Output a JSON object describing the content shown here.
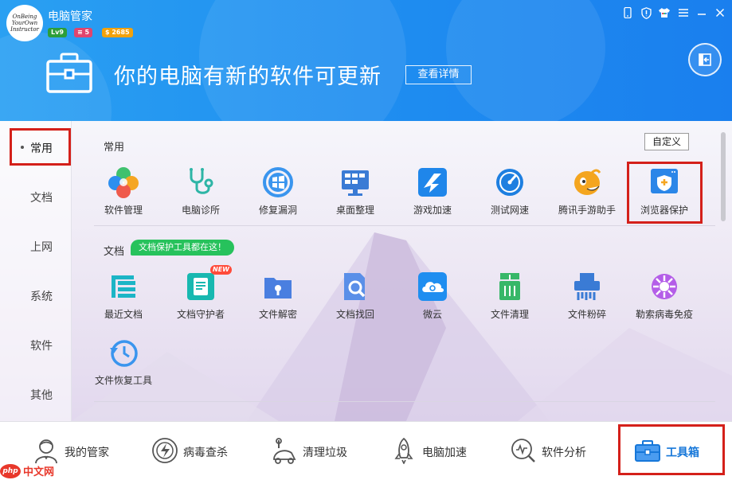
{
  "header": {
    "app_title": "电脑管家",
    "logo_text": "OnBeing YourOwn Instructor",
    "level": "Lv9",
    "vip": "5",
    "coins": "$ 2685",
    "headline": "你的电脑有新的软件可更新",
    "detail_button": "查看详情"
  },
  "sidebar": {
    "items": [
      {
        "label": "常用",
        "active": true
      },
      {
        "label": "文档"
      },
      {
        "label": "上网"
      },
      {
        "label": "系统"
      },
      {
        "label": "软件"
      },
      {
        "label": "其他"
      }
    ]
  },
  "main": {
    "custom_button": "自定义",
    "sections": [
      {
        "title": "常用",
        "tools": [
          {
            "label": "软件管理",
            "icon": "clover-icon"
          },
          {
            "label": "电脑诊所",
            "icon": "stethoscope-icon"
          },
          {
            "label": "修复漏洞",
            "icon": "windows-repair-icon"
          },
          {
            "label": "桌面整理",
            "icon": "desktop-icon"
          },
          {
            "label": "游戏加速",
            "icon": "game-boost-icon"
          },
          {
            "label": "测试网速",
            "icon": "speedometer-icon"
          },
          {
            "label": "腾讯手游助手",
            "icon": "game-mascot-icon"
          },
          {
            "label": "浏览器保护",
            "icon": "browser-shield-icon"
          }
        ]
      },
      {
        "title": "文档",
        "tag": "文档保护工具都在这！",
        "tools": [
          {
            "label": "最近文档",
            "icon": "stack-icon"
          },
          {
            "label": "文档守护者",
            "icon": "doc-guard-icon",
            "new_tag": "NEW"
          },
          {
            "label": "文件解密",
            "icon": "folder-key-icon"
          },
          {
            "label": "文档找回",
            "icon": "doc-search-icon"
          },
          {
            "label": "微云",
            "icon": "cloud-icon"
          },
          {
            "label": "文件清理",
            "icon": "trash-icon"
          },
          {
            "label": "文件粉碎",
            "icon": "shredder-icon"
          },
          {
            "label": "勒索病毒免疫",
            "icon": "virus-immune-icon"
          },
          {
            "label": "文件恢复工具",
            "icon": "clock-restore-icon"
          }
        ]
      }
    ]
  },
  "bottom_nav": {
    "items": [
      {
        "label": "我的管家",
        "icon": "butler-icon"
      },
      {
        "label": "病毒查杀",
        "icon": "virus-scan-icon"
      },
      {
        "label": "清理垃圾",
        "icon": "vacuum-icon"
      },
      {
        "label": "电脑加速",
        "icon": "rocket-icon"
      },
      {
        "label": "软件分析",
        "icon": "analysis-icon"
      },
      {
        "label": "工具箱",
        "icon": "toolbox-icon",
        "active": true
      }
    ]
  },
  "watermark": {
    "badge": "php",
    "site": "中文网"
  },
  "colors": {
    "header_blue": "#1f8ef0",
    "accent_blue": "#1677d9",
    "highlight_red": "#d4201a",
    "tag_green": "#27c25c"
  }
}
